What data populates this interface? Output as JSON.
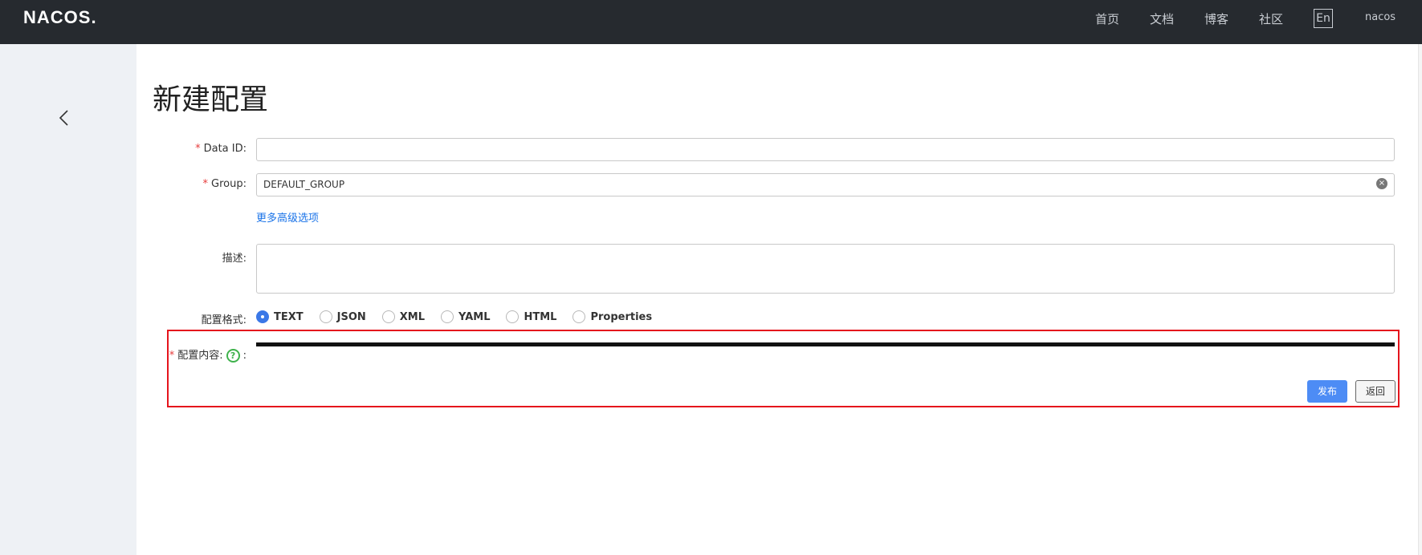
{
  "header": {
    "logo": "NACOS.",
    "nav": [
      "首页",
      "文档",
      "博客",
      "社区"
    ],
    "lang_button": "En",
    "user": "nacos"
  },
  "page": {
    "title": "新建配置"
  },
  "form": {
    "data_id_label": "Data ID:",
    "data_id_value": "",
    "group_label": "Group:",
    "group_value": "DEFAULT_GROUP",
    "advanced_link": "更多高级选项",
    "description_label": "描述:",
    "format_label": "配置格式:",
    "formats": [
      "TEXT",
      "JSON",
      "XML",
      "YAML",
      "HTML",
      "Properties"
    ],
    "selected_format": "TEXT",
    "content_label": "配置内容:",
    "content_help": "?",
    "content_colon": ":",
    "required_mark": "*"
  },
  "actions": {
    "publish": "发布",
    "back": "返回"
  },
  "colors": {
    "topbar": "#262a2f",
    "sidebar": "#eef1f5",
    "accent": "#4d8cf5",
    "highlight": "#e5141c",
    "help_icon": "#3fb24c"
  }
}
